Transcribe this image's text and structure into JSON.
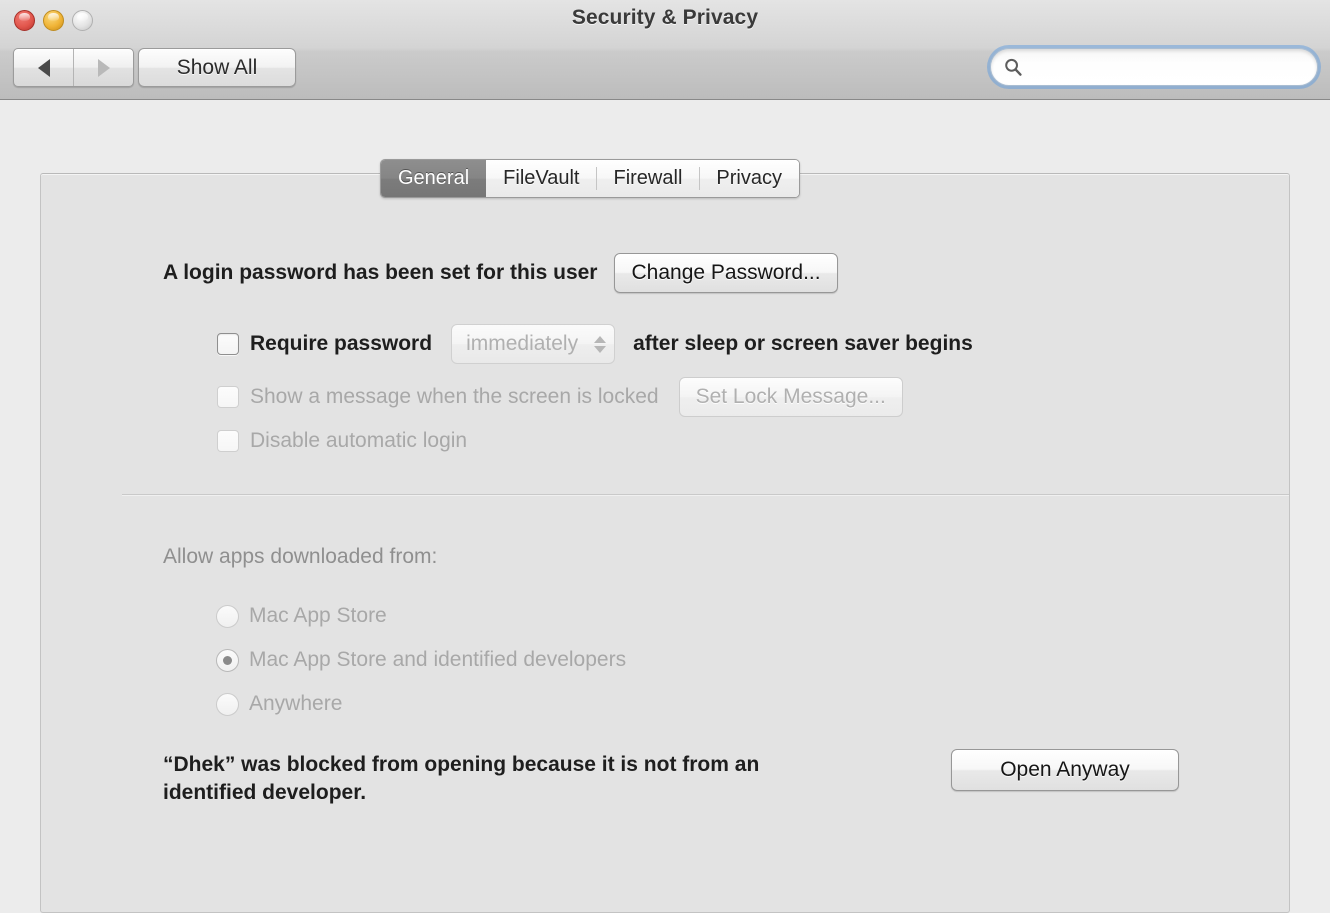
{
  "window": {
    "title": "Security & Privacy",
    "traffic_lights": [
      {
        "name": "close",
        "state": "enabled",
        "color": "#e2574d"
      },
      {
        "name": "minimize",
        "state": "enabled",
        "color": "#f0b437"
      },
      {
        "name": "zoom",
        "state": "disabled",
        "color": "#e4e4e4"
      }
    ]
  },
  "toolbar": {
    "back_label": "◀",
    "forward_label": "▶",
    "back_enabled": true,
    "forward_enabled": false,
    "show_all_label": "Show All",
    "search": {
      "value": "",
      "placeholder": "",
      "icon": "search-icon",
      "focused": true
    }
  },
  "tabs": [
    {
      "label": "General",
      "selected": true
    },
    {
      "label": "FileVault",
      "selected": false
    },
    {
      "label": "Firewall",
      "selected": false
    },
    {
      "label": "Privacy",
      "selected": false
    }
  ],
  "login_section": {
    "password_status_label": "A login password has been set for this user",
    "change_password_button": "Change Password...",
    "require_password": {
      "checkbox_label": "Require password",
      "checked": false,
      "enabled": true,
      "delay_value": "immediately",
      "delay_enabled": false,
      "suffix_label": "after sleep or screen saver begins"
    },
    "show_message": {
      "checkbox_label": "Show a message when the screen is locked",
      "checked": false,
      "enabled": false,
      "button_label": "Set Lock Message...",
      "button_enabled": false
    },
    "disable_auto_login": {
      "checkbox_label": "Disable automatic login",
      "checked": false,
      "enabled": false
    }
  },
  "gatekeeper_section": {
    "heading": "Allow apps downloaded from:",
    "enabled": false,
    "options": [
      {
        "label": "Mac App Store",
        "selected": false
      },
      {
        "label": "Mac App Store and identified developers",
        "selected": true
      },
      {
        "label": "Anywhere",
        "selected": false
      }
    ],
    "blocked_message_line1": "“Dhek” was blocked from opening because it is not from an",
    "blocked_message_line2": "identified developer.",
    "open_anyway_button": "Open Anyway"
  },
  "colors": {
    "window_chrome": "#d4d4d4",
    "panel_background": "#e3e3e3",
    "selected_tab": "#858585",
    "focus_ring": "#6aa0dc",
    "disabled_text": "#a8a8a8",
    "body_text": "#1e1e1e"
  }
}
